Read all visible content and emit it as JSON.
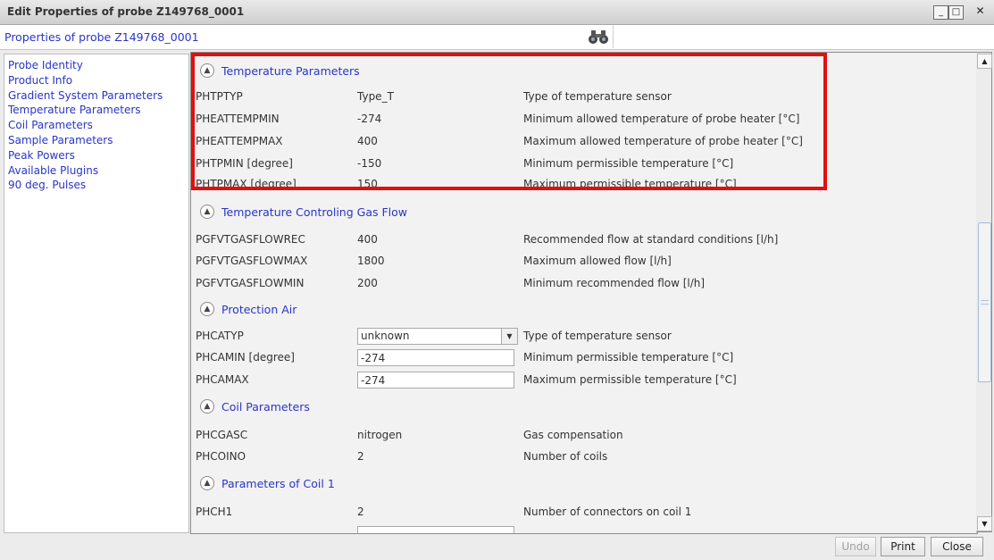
{
  "window": {
    "title": "Edit Properties of probe  Z149768_0001",
    "min_label": "_",
    "max_label": "□",
    "close_label": "✕"
  },
  "header": {
    "properties_label": "Properties of probe  Z149768_0001",
    "search_value": ""
  },
  "sidebar": {
    "items": [
      {
        "label": "Probe Identity"
      },
      {
        "label": "Product Info"
      },
      {
        "label": "Gradient System Parameters"
      },
      {
        "label": "Temperature Parameters"
      },
      {
        "label": "Coil Parameters"
      },
      {
        "label": "Sample Parameters"
      },
      {
        "label": "Peak Powers"
      },
      {
        "label": "Available Plugins"
      },
      {
        "label": "90 deg. Pulses"
      }
    ]
  },
  "sections": {
    "temperature": {
      "title": "Temperature Parameters",
      "rows": [
        {
          "name": "PHTPTYP",
          "value": "Type_T",
          "desc": "Type of temperature sensor"
        },
        {
          "name": "PHEATTEMPMIN",
          "value": "-274",
          "desc": "Minimum allowed temperature of probe heater [°C]"
        },
        {
          "name": "PHEATTEMPMAX",
          "value": "400",
          "desc": "Maximum allowed temperature of probe heater [°C]"
        },
        {
          "name": "PHTPMIN [degree]",
          "value": "-150",
          "desc": "Minimum permissible temperature [°C]"
        },
        {
          "name": "PHTPMAX [degree]",
          "value": "150",
          "desc": "Maximum permissible temperature [°C]"
        }
      ]
    },
    "gasflow": {
      "title": "Temperature Controling Gas Flow",
      "rows": [
        {
          "name": "PGFVTGASFLOWREC",
          "value": "400",
          "desc": "Recommended flow at standard conditions [l/h]"
        },
        {
          "name": "PGFVTGASFLOWMAX",
          "value": "1800",
          "desc": "Maximum allowed flow [l/h]"
        },
        {
          "name": "PGFVTGASFLOWMIN",
          "value": "200",
          "desc": "Minimum recommended flow [l/h]"
        }
      ]
    },
    "protection": {
      "title": "Protection Air",
      "rows": [
        {
          "name": "PHCATYP",
          "value": "unknown",
          "desc": "Type of temperature sensor"
        },
        {
          "name": "PHCAMIN [degree]",
          "value": "-274",
          "desc": "Minimum permissible temperature [°C]"
        },
        {
          "name": "PHCAMAX",
          "value": "-274",
          "desc": "Maximum permissible temperature [°C]"
        }
      ]
    },
    "coil": {
      "title": "Coil Parameters",
      "rows": [
        {
          "name": "PHCGASC",
          "value": "nitrogen",
          "desc": "Gas compensation"
        },
        {
          "name": "PHCOINO",
          "value": "2",
          "desc": "Number of coils"
        }
      ]
    },
    "coil1": {
      "title": "Parameters of Coil 1",
      "rows": [
        {
          "name": "PHCH1",
          "value": "2",
          "desc": "Number of connectors on coil 1"
        }
      ]
    }
  },
  "footer": {
    "undo_label": "Undo",
    "print_label": "Print",
    "close_label": "Close"
  },
  "colors": {
    "highlight_border": "#e01010",
    "link_blue": "#2a35c4"
  }
}
